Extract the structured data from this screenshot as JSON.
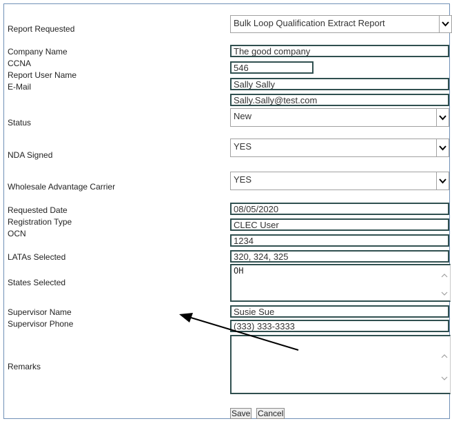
{
  "labels": {
    "report_requested": "Report Requested",
    "company_name": "Company Name",
    "ccna": "CCNA",
    "report_user_name": "Report User Name",
    "email": "E-Mail",
    "status": "Status",
    "nda_signed": "NDA Signed",
    "wholesale_advantage_carrier": "Wholesale Advantage Carrier",
    "requested_date": "Requested Date",
    "registration_type": "Registration Type",
    "ocn": "OCN",
    "latas_selected": "LATAs Selected",
    "states_selected": "States Selected",
    "supervisor_name": "Supervisor Name",
    "supervisor_phone": "Supervisor Phone",
    "remarks": "Remarks"
  },
  "values": {
    "report_requested": "Bulk Loop Qualification Extract Report",
    "company_name": "The good company",
    "ccna": "546",
    "report_user_name": "Sally Sally",
    "email": "Sally.Sally@test.com",
    "status": "New",
    "nda_signed": "YES",
    "wholesale_advantage_carrier": "YES",
    "requested_date": "08/05/2020",
    "registration_type": "CLEC User",
    "ocn": "1234",
    "latas_selected": "320, 324, 325",
    "states_selected": "OH",
    "supervisor_name": "Susie  Sue",
    "supervisor_phone": "(333) 333-3333",
    "remarks": ""
  },
  "buttons": {
    "save": "Save",
    "cancel": "Cancel"
  },
  "icons": {
    "dropdown": "chevron-down-icon",
    "scroll_up": "scroll-up-icon",
    "scroll_down": "scroll-down-icon",
    "pointer": "arrow-annotation"
  }
}
